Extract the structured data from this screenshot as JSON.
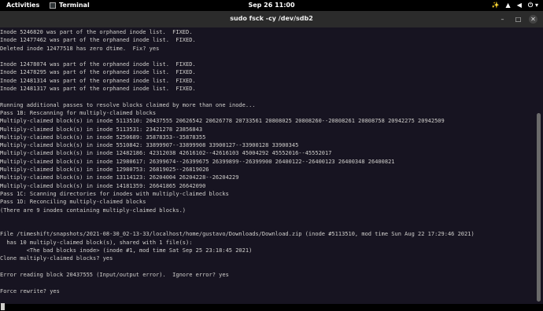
{
  "topbar": {
    "activities": "Activities",
    "app_name": "Terminal",
    "clock": "Sep 26  11:00",
    "tray": [
      "✨",
      "▲",
      "◀",
      "⏻ ▾"
    ]
  },
  "window": {
    "title": "sudo fsck -cy /dev/sdb2",
    "minimize": "–",
    "maximize": "□",
    "close": "✕"
  },
  "terminal": {
    "lines": [
      "Inode 5246820 was part of the orphaned inode list.  FIXED.",
      "Inode 12477462 was part of the orphaned inode list.  FIXED.",
      "Deleted inode 12477518 has zero dtime.  Fix? yes",
      "",
      "Inode 12478074 was part of the orphaned inode list.  FIXED.",
      "Inode 12478295 was part of the orphaned inode list.  FIXED.",
      "Inode 12481314 was part of the orphaned inode list.  FIXED.",
      "Inode 12481317 was part of the orphaned inode list.  FIXED.",
      "",
      "Running additional passes to resolve blocks claimed by more than one inode...",
      "Pass 1B: Rescanning for multiply-claimed blocks",
      "Multiply-claimed block(s) in inode 5113510: 20437555 20626542 20626778 20733561 20808025 20808260--20808261 20808758 20942275 20942509",
      "Multiply-claimed block(s) in inode 5113531: 23421278 23856843",
      "Multiply-claimed block(s) in inode 5250689: 35878353--35878355",
      "Multiply-claimed block(s) in inode 5510842: 33899907--33899908 33900127--33900128 33900345",
      "Multiply-claimed block(s) in inode 12482186: 42312038 42616102--42616103 45004292 45552016--45552017",
      "Multiply-claimed block(s) in inode 12980617: 26399674--26399675 26399899--26399900 26400122--26400123 26400348 26400821",
      "Multiply-claimed block(s) in inode 12980753: 26819025--26819026",
      "Multiply-claimed block(s) in inode 13114123: 26204004 26204228--26204229",
      "Multiply-claimed block(s) in inode 14181359: 26641865 26642090",
      "Pass 1C: Scanning directories for inodes with multiply-claimed blocks",
      "Pass 1D: Reconciling multiply-claimed blocks",
      "(There are 9 inodes containing multiply-claimed blocks.)",
      "",
      "",
      "File /timeshift/snapshots/2021-08-30_02-13-33/localhost/home/gustavo/Downloads/Download.zip (inode #5113510, mod time Sun Aug 22 17:29:46 2021)",
      "  has 10 multiply-claimed block(s), shared with 1 file(s):",
      "        <The bad blocks inode> (inode #1, mod time Sat Sep 25 23:18:45 2021)",
      "Clone multiply-claimed blocks? yes",
      "",
      "Error reading block 20437555 (Input/output error).  Ignore error? yes",
      "",
      "Force rewrite? yes",
      "",
      ""
    ]
  }
}
